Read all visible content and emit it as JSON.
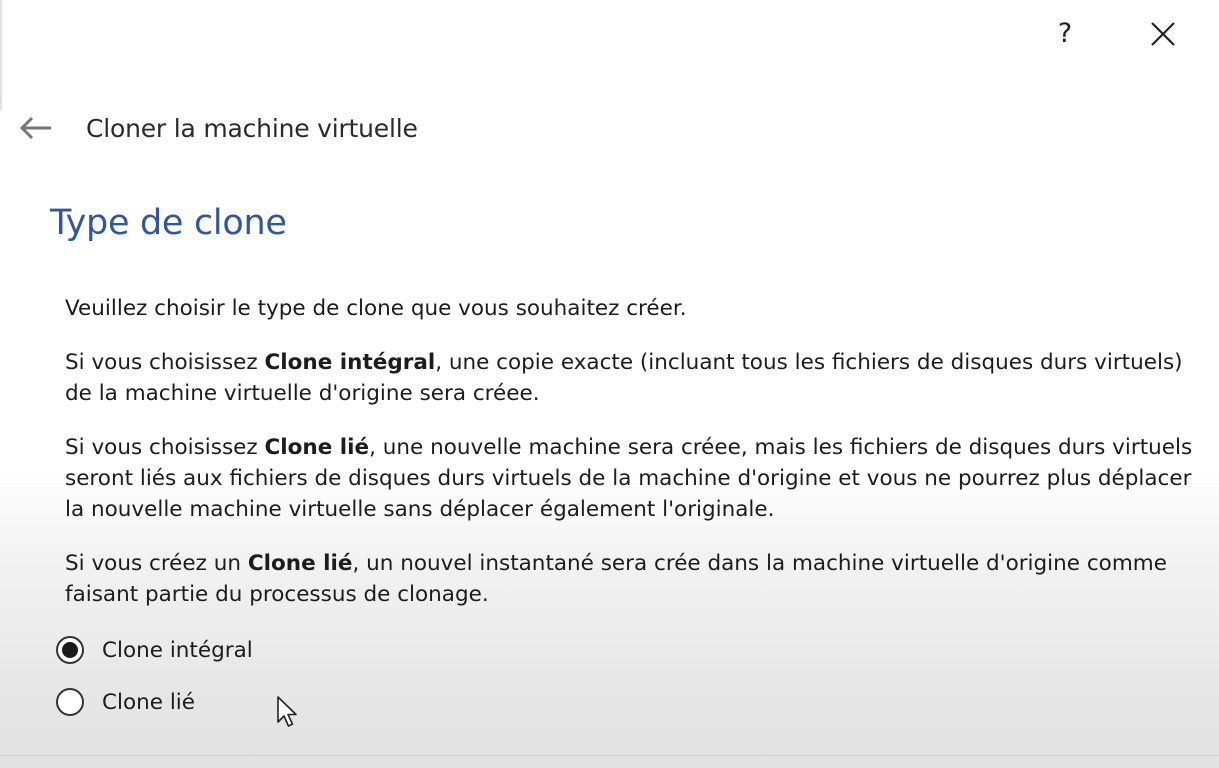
{
  "titlebar": {
    "help_label": "?",
    "close_icon": "close-icon"
  },
  "header": {
    "back_icon": "arrow-left-icon",
    "title": "Cloner la machine virtuelle"
  },
  "page": {
    "heading": "Type de clone",
    "intro": "Veuillez choisir le type de clone que vous souhaitez créer.",
    "para_full": {
      "prefix": "Si vous choisissez ",
      "bold": "Clone intégral",
      "suffix": ", une copie exacte (incluant tous les fichiers de disques durs virtuels) de la machine virtuelle d'origine sera créee."
    },
    "para_linked": {
      "prefix": "Si vous choisissez ",
      "bold": "Clone lié",
      "suffix": ", une nouvelle machine sera créee, mais les fichiers de disques durs virtuels seront liés aux fichiers de disques durs virtuels de la machine d'origine et vous ne pourrez plus déplacer la nouvelle machine virtuelle sans déplacer également l'originale."
    },
    "para_snapshot": {
      "prefix": "Si vous créez un ",
      "bold": "Clone lié",
      "suffix": ", un nouvel instantané sera crée dans la machine virtuelle d'origine comme faisant partie du processus de clonage."
    }
  },
  "options": [
    {
      "label": "Clone intégral",
      "selected": true
    },
    {
      "label": "Clone lié",
      "selected": false
    }
  ],
  "colors": {
    "heading": "#2e57a0",
    "text": "#1c1c1c"
  }
}
